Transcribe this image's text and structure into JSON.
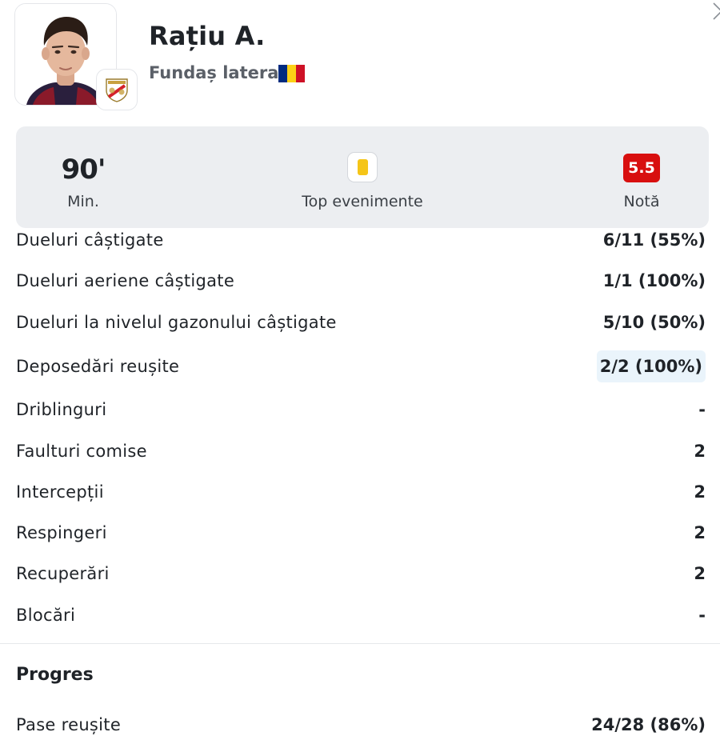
{
  "player": {
    "name": "Rațiu A.",
    "position": "Fundaș lateral",
    "flag_colors": [
      "#002B7F",
      "#FCD116",
      "#CE1126"
    ],
    "club_badge_icon": "rayo-vallecano-crest-icon"
  },
  "summary": {
    "minutes_value": "90'",
    "minutes_label": "Min.",
    "events_label": "Top evenimente",
    "events_icon": "yellow-card-icon",
    "rating_value": "5.5",
    "rating_label": "Notă",
    "rating_color": "#d80f0f"
  },
  "stats": [
    {
      "label": "Dueluri câștigate",
      "value": "6/11 (55%)"
    },
    {
      "label": "Dueluri aeriene câștigate",
      "value": "1/1 (100%)"
    },
    {
      "label": "Dueluri la nivelul gazonului câștigate",
      "value": "5/10 (50%)"
    },
    {
      "label": "Deposedări reușite",
      "value": "2/2 (100%)"
    },
    {
      "label": "Driblinguri",
      "value": "-"
    },
    {
      "label": "Faulturi comise",
      "value": "2"
    },
    {
      "label": "Intercepții",
      "value": "2"
    },
    {
      "label": "Respingeri",
      "value": "2"
    },
    {
      "label": "Recuperări",
      "value": "2"
    },
    {
      "label": "Blocări",
      "value": "-"
    }
  ],
  "progress_section": {
    "title": "Progres",
    "stats": [
      {
        "label": "Pase reușite",
        "value": "24/28 (86%)"
      }
    ]
  }
}
